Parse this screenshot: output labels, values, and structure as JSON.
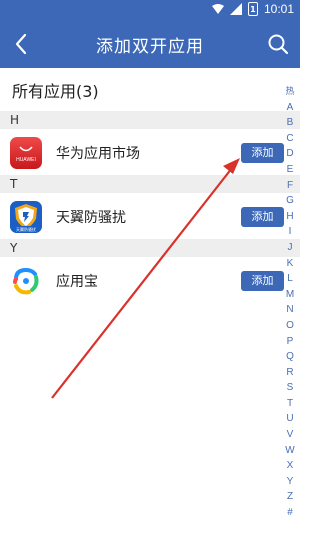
{
  "status": {
    "time": "10:01",
    "battery_label": "1"
  },
  "header": {
    "title": "添加双开应用"
  },
  "section": {
    "title": "所有应用(3)"
  },
  "groups": [
    {
      "letter": "H",
      "app": {
        "name": "华为应用市场",
        "icon_text": "HUAWEI",
        "icon": "huawei-appgallery-icon"
      }
    },
    {
      "letter": "T",
      "app": {
        "name": "天翼防骚扰",
        "icon_text": "天翼防骚扰",
        "icon": "tianyi-shield-icon"
      }
    },
    {
      "letter": "Y",
      "app": {
        "name": "应用宝",
        "icon": "yingyongbao-icon"
      }
    }
  ],
  "add_label": "添加",
  "alphabet": [
    "热",
    "A",
    "B",
    "C",
    "D",
    "E",
    "F",
    "G",
    "H",
    "I",
    "J",
    "K",
    "L",
    "M",
    "N",
    "O",
    "P",
    "Q",
    "R",
    "S",
    "T",
    "U",
    "V",
    "W",
    "X",
    "Y",
    "Z",
    "#"
  ],
  "colors": {
    "primary": "#3c68b7",
    "arrow": "#d9322b"
  }
}
